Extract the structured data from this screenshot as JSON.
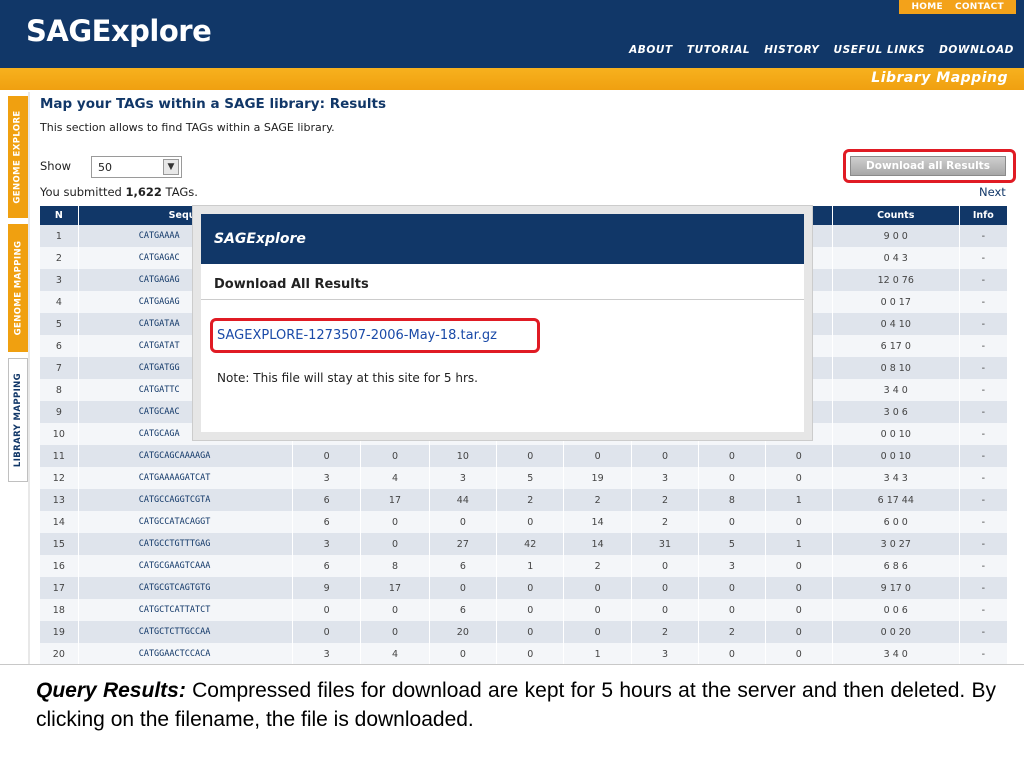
{
  "header": {
    "logo": "SAGExplore",
    "top_links": [
      "HOME",
      "CONTACT"
    ],
    "nav": [
      "ABOUT",
      "TUTORIAL",
      "HISTORY",
      "USEFUL LINKS",
      "DOWNLOAD"
    ],
    "section_title": "Library Mapping"
  },
  "side_tabs": [
    "GENOME EXPLORE",
    "GENOME MAPPING",
    "LIBRARY MAPPING"
  ],
  "content": {
    "title": "Map your TAGs within a SAGE library: Results",
    "description": "This section allows to find TAGs within a SAGE library.",
    "show_label": "Show",
    "show_value": "50",
    "submitted_prefix": "You submitted ",
    "submitted_count": "1,622",
    "submitted_suffix": " TAGs.",
    "download_button": "Download all Results",
    "next_link": "Next"
  },
  "table": {
    "headers": [
      "N",
      "Seque",
      "",
      "",
      "",
      "",
      "",
      "",
      "",
      "",
      "Counts",
      "Info"
    ],
    "rows": [
      [
        "1",
        "CATGAAAA",
        "",
        "",
        "",
        "",
        "",
        "",
        "",
        "",
        "9 0 0",
        "-"
      ],
      [
        "2",
        "CATGAGAC",
        "",
        "",
        "",
        "",
        "",
        "",
        "",
        "",
        "0 4 3",
        "-"
      ],
      [
        "3",
        "CATGAGAG",
        "",
        "",
        "",
        "",
        "",
        "",
        "",
        "",
        "12 0 76",
        "-"
      ],
      [
        "4",
        "CATGAGAG",
        "",
        "",
        "",
        "",
        "",
        "",
        "",
        "",
        "0 0 17",
        "-"
      ],
      [
        "5",
        "CATGATAA",
        "",
        "",
        "",
        "",
        "",
        "",
        "",
        "",
        "0 4 10",
        "-"
      ],
      [
        "6",
        "CATGATAT",
        "",
        "",
        "",
        "",
        "",
        "",
        "",
        "",
        "6 17 0",
        "-"
      ],
      [
        "7",
        "CATGATGG",
        "",
        "",
        "",
        "",
        "",
        "",
        "",
        "",
        "0 8 10",
        "-"
      ],
      [
        "8",
        "CATGATTC",
        "",
        "",
        "",
        "",
        "",
        "",
        "",
        "",
        "3 4 0",
        "-"
      ],
      [
        "9",
        "CATGCAAC",
        "",
        "",
        "",
        "",
        "",
        "",
        "",
        "",
        "3 0 6",
        "-"
      ],
      [
        "10",
        "CATGCAGA",
        "",
        "",
        "",
        "",
        "",
        "",
        "",
        "",
        "0 0 10",
        "-"
      ],
      [
        "11",
        "CATGCAGCAAAAGA",
        "0",
        "0",
        "10",
        "0",
        "0",
        "0",
        "0",
        "0",
        "0 0 10",
        "-"
      ],
      [
        "12",
        "CATGAAAAGATCAT",
        "3",
        "4",
        "3",
        "5",
        "19",
        "3",
        "0",
        "0",
        "3 4 3",
        "-"
      ],
      [
        "13",
        "CATGCCAGGTCGTA",
        "6",
        "17",
        "44",
        "2",
        "2",
        "2",
        "8",
        "1",
        "6 17 44",
        "-"
      ],
      [
        "14",
        "CATGCCATACAGGT",
        "6",
        "0",
        "0",
        "0",
        "14",
        "2",
        "0",
        "0",
        "6 0 0",
        "-"
      ],
      [
        "15",
        "CATGCCTGTTTGAG",
        "3",
        "0",
        "27",
        "42",
        "14",
        "31",
        "5",
        "1",
        "3 0 27",
        "-"
      ],
      [
        "16",
        "CATGCGAAGTCAAA",
        "6",
        "8",
        "6",
        "1",
        "2",
        "0",
        "3",
        "0",
        "6 8 6",
        "-"
      ],
      [
        "17",
        "CATGCGTCAGTGTG",
        "9",
        "17",
        "0",
        "0",
        "0",
        "0",
        "0",
        "0",
        "9 17 0",
        "-"
      ],
      [
        "18",
        "CATGCTCATTATCT",
        "0",
        "0",
        "6",
        "0",
        "0",
        "0",
        "0",
        "0",
        "0 0 6",
        "-"
      ],
      [
        "19",
        "CATGCTCTTGCCAA",
        "0",
        "0",
        "20",
        "0",
        "0",
        "2",
        "2",
        "0",
        "0 0 20",
        "-"
      ],
      [
        "20",
        "CATGGAACTCCACA",
        "3",
        "4",
        "0",
        "0",
        "1",
        "3",
        "0",
        "0",
        "3 4 0",
        "-"
      ]
    ]
  },
  "modal": {
    "brand": "SAGExplore",
    "title": "Download All Results",
    "file_link": "SAGEXPLORE-1273507-2006-May-18.tar.gz",
    "note": "Note: This file will stay at this site for 5 hrs."
  },
  "caption": {
    "label": "Query Results:",
    "text": " Compressed files for download are kept for 5 hours at the server and then deleted. By clicking on the filename, the file is downloaded."
  },
  "colors": {
    "header_navy": "#113768",
    "accent_orange": "#f0a010",
    "highlight_red": "#e01b24"
  }
}
